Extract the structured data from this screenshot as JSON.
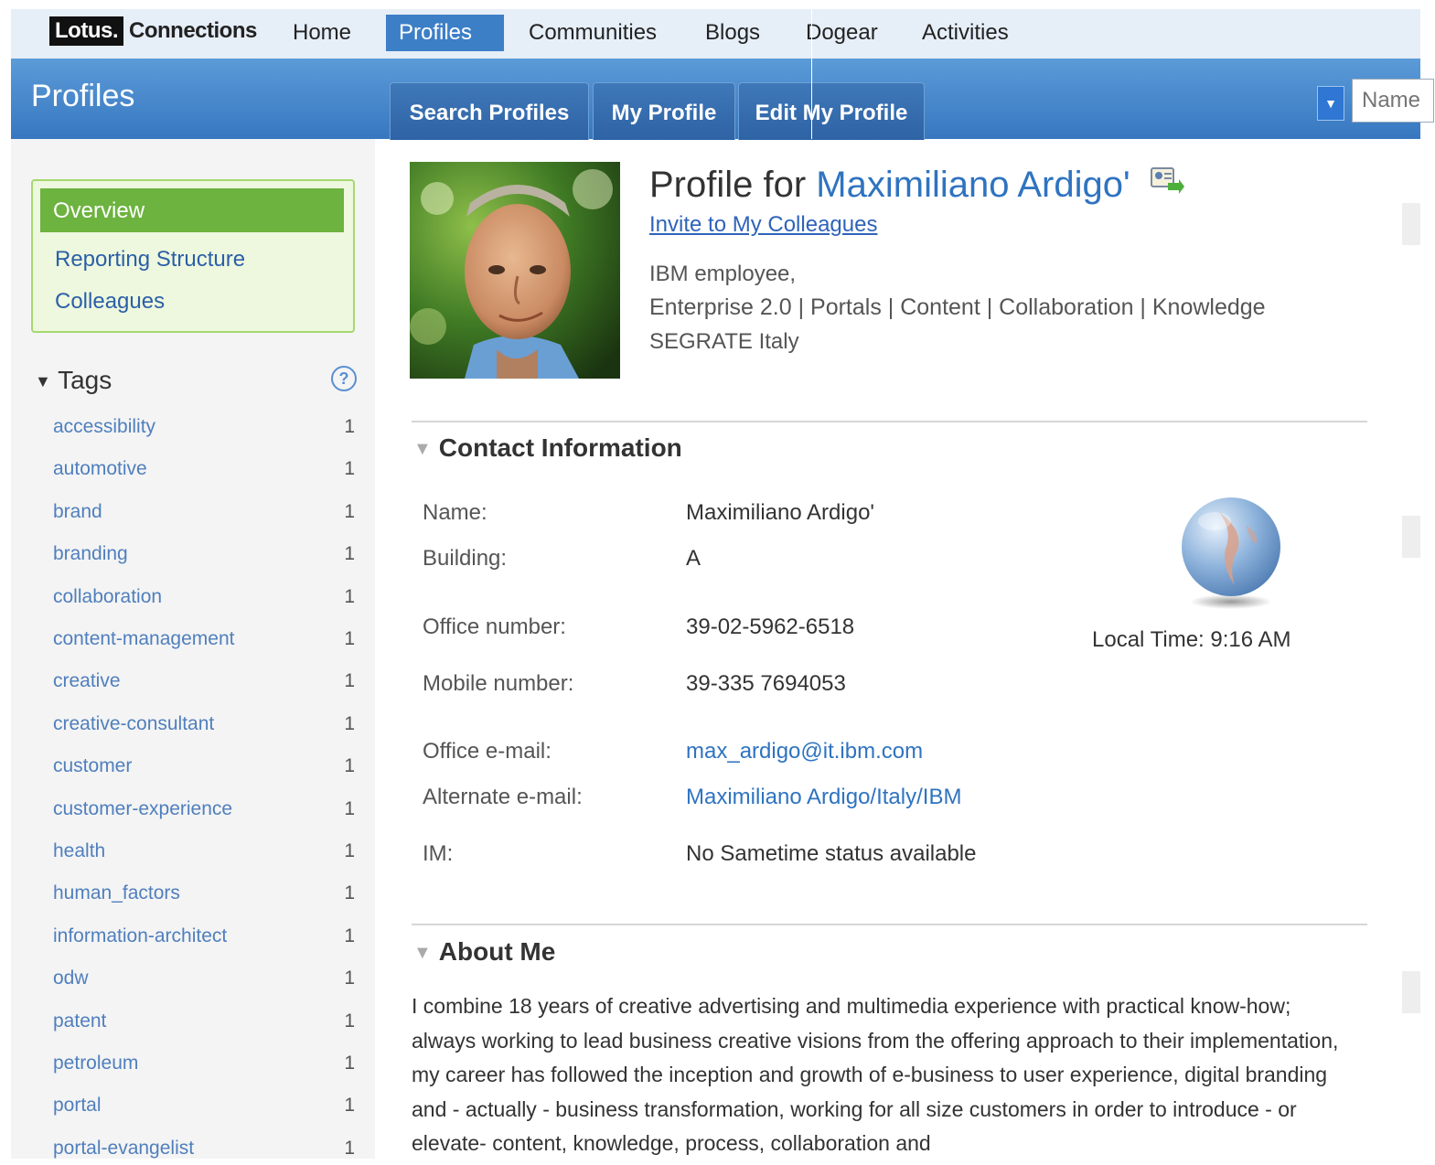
{
  "topnav": {
    "logo_lotus": "Lotus.",
    "logo_connections": "Connections",
    "links": [
      "Home",
      "Profiles",
      "Communities",
      "Blogs",
      "Dogear",
      "Activities"
    ]
  },
  "header": {
    "app_title": "Profiles",
    "tabs": [
      "Search Profiles",
      "My Profile",
      "Edit My Profile"
    ],
    "search_placeholder": "Name"
  },
  "sidebar": {
    "nav": [
      "Overview",
      "Reporting Structure",
      "Colleagues"
    ],
    "tags_title": "Tags",
    "help": "?",
    "tags": [
      {
        "name": "accessibility",
        "count": "1"
      },
      {
        "name": "automotive",
        "count": "1"
      },
      {
        "name": "brand",
        "count": "1"
      },
      {
        "name": "branding",
        "count": "1"
      },
      {
        "name": "collaboration",
        "count": "1"
      },
      {
        "name": "content-management",
        "count": "1"
      },
      {
        "name": "creative",
        "count": "1"
      },
      {
        "name": "creative-consultant",
        "count": "1"
      },
      {
        "name": "customer",
        "count": "1"
      },
      {
        "name": "customer-experience",
        "count": "1"
      },
      {
        "name": "health",
        "count": "1"
      },
      {
        "name": "human_factors",
        "count": "1"
      },
      {
        "name": "information-architect",
        "count": "1"
      },
      {
        "name": "odw",
        "count": "1"
      },
      {
        "name": "patent",
        "count": "1"
      },
      {
        "name": "petroleum",
        "count": "1"
      },
      {
        "name": "portal",
        "count": "1"
      },
      {
        "name": "portal-evangelist",
        "count": "1"
      }
    ]
  },
  "profile": {
    "title_prefix": "Profile for",
    "name": "Maximiliano Ardigo'",
    "invite": "Invite to My Colleagues",
    "employee": "IBM employee,",
    "job_title": "Enterprise 2.0 | Portals | Content | Collaboration | Knowledge",
    "location": "SEGRATE Italy"
  },
  "contact": {
    "heading": "Contact Information",
    "rows": [
      {
        "label": "Name:",
        "value": "Maximiliano Ardigo'"
      },
      {
        "label": "Building:",
        "value": "A"
      },
      {
        "label": "Office number:",
        "value": "39-02-5962-6518"
      },
      {
        "label": "Mobile number:",
        "value": "39-335 7694053"
      },
      {
        "label": "Office e-mail:",
        "value": "max_ardigo@it.ibm.com"
      },
      {
        "label": "Alternate e-mail:",
        "value": "Maximiliano Ardigo/Italy/IBM"
      },
      {
        "label": "IM:",
        "value": "No Sametime status available"
      }
    ],
    "local_time": "Local Time: 9:16 AM"
  },
  "about": {
    "heading": "About Me",
    "text": "I combine 18 years of creative advertising and multimedia experience with practical know-how; always working to lead business creative visions from the offering approach to their implementation, my career has followed the inception and growth of e-business to user experience, digital branding and - actually - business transformation, working for all size customers in order to introduce - or elevate- content, knowledge, process, collaboration and"
  },
  "colors": {
    "header_blue": "#3d7fc7",
    "overview_green": "#6db33f",
    "link_blue": "#2f73c0"
  }
}
